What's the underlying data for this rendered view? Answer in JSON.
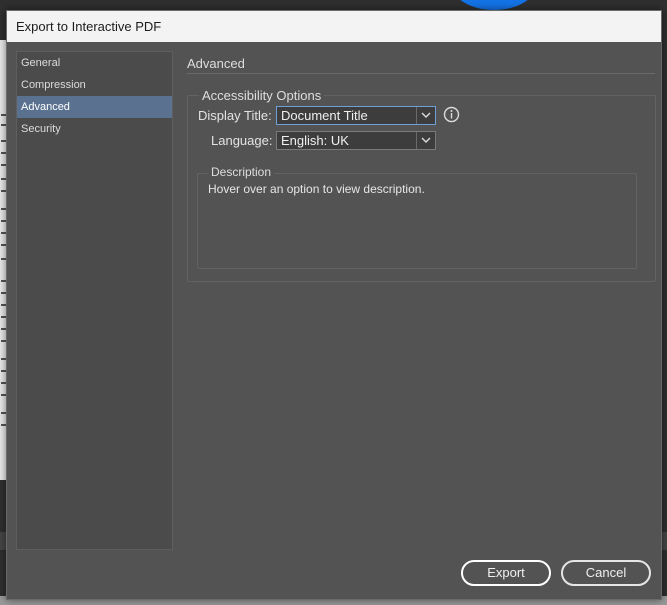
{
  "dialog": {
    "title": "Export to Interactive PDF"
  },
  "sidebar": {
    "items": [
      {
        "label": "General"
      },
      {
        "label": "Compression"
      },
      {
        "label": "Advanced",
        "selected": true
      },
      {
        "label": "Security"
      }
    ]
  },
  "panel": {
    "title": "Advanced",
    "accessibility": {
      "legend": "Accessibility Options",
      "display_title_label": "Display Title:",
      "display_title_value": "Document Title",
      "language_label": "Language:",
      "language_value": "English: UK",
      "info_icon": "info-circle-icon"
    },
    "description": {
      "legend": "Description",
      "text": "Hover over an option to view description."
    }
  },
  "buttons": {
    "export_label": "Export",
    "cancel_label": "Cancel"
  },
  "colors": {
    "dialog_bg": "#535353",
    "selected_item": "#5a7290",
    "focus_border": "#6f9fd6"
  }
}
